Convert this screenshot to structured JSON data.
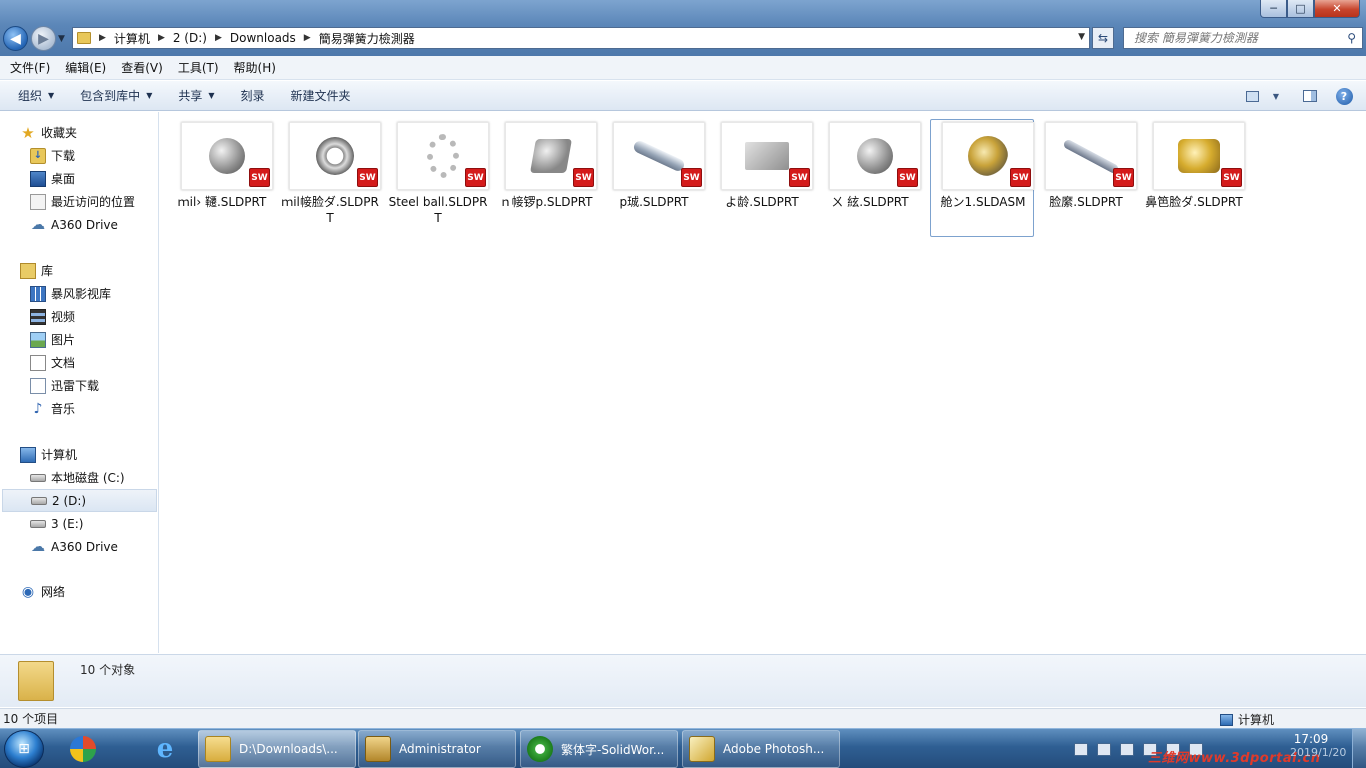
{
  "window": {
    "minimize_label": "─",
    "maximize_label": "□",
    "close_label": "✕"
  },
  "address": {
    "crumbs": [
      "计算机",
      "2 (D:)",
      "Downloads",
      "簡易彈簧力檢測器"
    ]
  },
  "search": {
    "placeholder": "搜索 簡易彈簧力檢測器"
  },
  "menubar": {
    "items": [
      "文件(F)",
      "编辑(E)",
      "查看(V)",
      "工具(T)",
      "帮助(H)"
    ]
  },
  "toolbar": {
    "organize": "组织",
    "include_in_library": "包含到库中",
    "share": "共享",
    "burn": "刻录",
    "new_folder": "新建文件夹",
    "help_glyph": "?"
  },
  "navpane": {
    "favorites": {
      "label": "收藏夹",
      "items": [
        "下载",
        "桌面",
        "最近访问的位置",
        "A360 Drive"
      ]
    },
    "libraries": {
      "label": "库",
      "items": [
        "暴风影视库",
        "视频",
        "图片",
        "文档",
        "迅雷下载",
        "音乐"
      ]
    },
    "computer": {
      "label": "计算机",
      "items": [
        "本地磁盘 (C:)",
        "2 (D:)",
        "3 (E:)",
        "A360 Drive"
      ],
      "selected": "2 (D:)"
    },
    "network": {
      "label": "网络"
    }
  },
  "files": [
    {
      "name": "ｍil›  韆.SLDPRT",
      "thumb": "bearing",
      "badge": "SW"
    },
    {
      "name": "ｍil帹脸ダ.SLDPRT",
      "thumb": "ring",
      "badge": "SW"
    },
    {
      "name": "Steel ball.SLDPRT",
      "thumb": "beads",
      "badge": "SW"
    },
    {
      "name": "ｎ帹锣p.SLDPRT",
      "thumb": "bolt",
      "badge": "SW"
    },
    {
      "name": "p珹.SLDPRT",
      "thumb": "rod",
      "badge": "SW"
    },
    {
      "name": "よ龄.SLDPRT",
      "thumb": "block",
      "badge": "SW"
    },
    {
      "name": "ㄨ   絃.SLDPRT",
      "thumb": "wheel",
      "badge": "SW"
    },
    {
      "name": "舱ン1.SLDASM",
      "thumb": "assembly",
      "badge": "SW",
      "selected": true
    },
    {
      "name": "脸縻.SLDPRT",
      "thumb": "long",
      "badge": "SW"
    },
    {
      "name": "鼻笆脸ダ.SLDPRT",
      "thumb": "brass",
      "badge": "SW"
    }
  ],
  "details": {
    "count_text": "10 个对象"
  },
  "statusbar": {
    "items_text": "10 个项目",
    "location_text": "计算机"
  },
  "taskbar": {
    "start_glyph": "⊞",
    "ie_glyph": "e",
    "buttons": [
      {
        "label": "D:\\Downloads\\...",
        "active": true
      },
      {
        "label": "Administrator",
        "active": false
      },
      {
        "label": "繁体字-SolidWor...",
        "active": false
      },
      {
        "label": "Adobe Photosh...",
        "active": false
      }
    ],
    "clock_time": "17:09",
    "clock_date": "2019/1/20",
    "watermark": "三维网www.3dportal.cn"
  },
  "colors": {
    "accent": "#4d78ab",
    "badge_red": "#d41b1b",
    "selection_border": "#7da2ce"
  }
}
